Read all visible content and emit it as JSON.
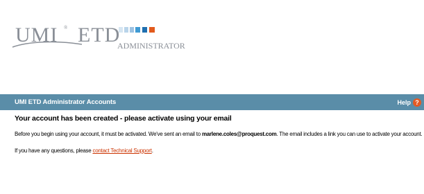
{
  "logo": {
    "umi": "UMI",
    "etd": "ETD",
    "administrator": "ADMINISTRATOR",
    "colors": {
      "text": "#8a8f97",
      "swoosh": "#8a8f97",
      "squares_light": [
        "#d6e6f2",
        "#b9d4ea",
        "#9cc2e2"
      ],
      "squares_blue": [
        "#3f9ad3",
        "#1f6fb0"
      ],
      "square_orange": "#e25a1c"
    }
  },
  "titlebar": {
    "title": "UMI ETD Administrator Accounts",
    "help_label": "Help",
    "help_icon": "question-icon",
    "background": "#5a8da8"
  },
  "content": {
    "heading": "Your account has been created - please activate using your email",
    "para1_pre": "Before you begin using your account, it must be activated. We've sent an email to ",
    "para1_email": "marlene.coles@proquest.com",
    "para1_post": ". The email includes a link you can use to activate your account.",
    "para2_pre": "If you have any questions, please ",
    "para2_link": "contact Technical Support",
    "para2_post": "."
  }
}
